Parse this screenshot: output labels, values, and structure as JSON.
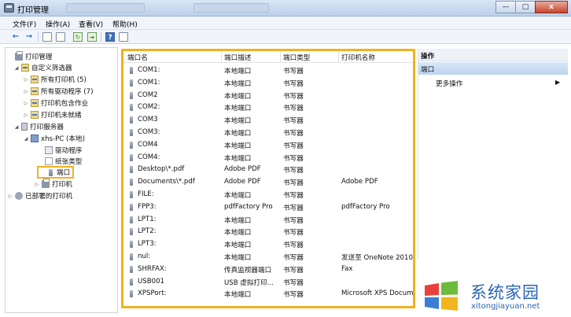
{
  "window": {
    "title": "打印管理",
    "controls": {
      "minimize": "—",
      "maximize": "□",
      "close": "x"
    }
  },
  "menu": [
    "文件(F)",
    "操作(A)",
    "查看(V)",
    "帮助(H)"
  ],
  "tree": [
    {
      "label": "打印管理",
      "icon": "printer-icon",
      "toggle": "",
      "indent": 0
    },
    {
      "label": "自定义筛选器",
      "icon": "filter-icon",
      "toggle": "◢",
      "indent": 1
    },
    {
      "label": "所有打印机 (5)",
      "icon": "filter-icon",
      "toggle": "▷",
      "indent": 2
    },
    {
      "label": "所有驱动程序 (7)",
      "icon": "filter-icon",
      "toggle": "▷",
      "indent": 2
    },
    {
      "label": "打印机包含作业",
      "icon": "filter-icon",
      "toggle": "▷",
      "indent": 2
    },
    {
      "label": "打印机未就绪",
      "icon": "filter-icon",
      "toggle": "▷",
      "indent": 2
    },
    {
      "label": "打印服务器",
      "icon": "server-icon",
      "toggle": "◢",
      "indent": 1
    },
    {
      "label": "xhs-PC (本地)",
      "icon": "computer-icon",
      "toggle": "◢",
      "indent": 2
    },
    {
      "label": "驱动程序",
      "icon": "driver-icon",
      "toggle": "",
      "indent": 3
    },
    {
      "label": "纸张类型",
      "icon": "form-icon",
      "toggle": "",
      "indent": 3
    },
    {
      "label": "端口",
      "icon": "port-icon",
      "toggle": "",
      "indent": 3,
      "selected": true
    },
    {
      "label": "打印机",
      "icon": "printer-icon",
      "toggle": "▷",
      "indent": 3
    },
    {
      "label": "已部署的打印机",
      "icon": "deployed-printer-icon",
      "toggle": "▷",
      "indent": 0
    }
  ],
  "table": {
    "columns": [
      "端口名",
      "端口描述",
      "端口类型",
      "打印机名称"
    ],
    "rows": [
      [
        "COM1:",
        "本地端口",
        "书写器",
        ""
      ],
      [
        "COM1:",
        "本地端口",
        "书写器",
        ""
      ],
      [
        "COM2",
        "本地端口",
        "书写器",
        ""
      ],
      [
        "COM2:",
        "本地端口",
        "书写器",
        ""
      ],
      [
        "COM3",
        "本地端口",
        "书写器",
        ""
      ],
      [
        "COM3:",
        "本地端口",
        "书写器",
        ""
      ],
      [
        "COM4",
        "本地端口",
        "书写器",
        ""
      ],
      [
        "COM4:",
        "本地端口",
        "书写器",
        ""
      ],
      [
        "Desktop\\*.pdf",
        "Adobe PDF",
        "书写器",
        ""
      ],
      [
        "Documents\\*.pdf",
        "Adobe PDF",
        "书写器",
        "Adobe PDF"
      ],
      [
        "FILE:",
        "本地端口",
        "书写器",
        ""
      ],
      [
        "FPP3:",
        "pdfFactory Pro",
        "书写器",
        "pdfFactory Pro"
      ],
      [
        "LPT1:",
        "本地端口",
        "书写器",
        ""
      ],
      [
        "LPT2:",
        "本地端口",
        "书写器",
        ""
      ],
      [
        "LPT3:",
        "本地端口",
        "书写器",
        ""
      ],
      [
        "nul:",
        "本地端口",
        "书写器",
        "发送至 OneNote 2010"
      ],
      [
        "SHRFAX:",
        "传真监视器端口",
        "书写器",
        "Fax"
      ],
      [
        "USB001",
        "USB 虚拟打印...",
        "书写器",
        ""
      ],
      [
        "XPSPort:",
        "本地端口",
        "书写器",
        "Microsoft XPS Document Writer"
      ]
    ]
  },
  "actions": {
    "header": "操作",
    "section": "端口",
    "more": "更多操作",
    "more_arrow": "▶"
  },
  "watermark": {
    "text": "系统家园",
    "url": "xitongjiayuan.net"
  },
  "colors": {
    "highlight": "#f2b11e",
    "brand": "#2a63b8"
  }
}
